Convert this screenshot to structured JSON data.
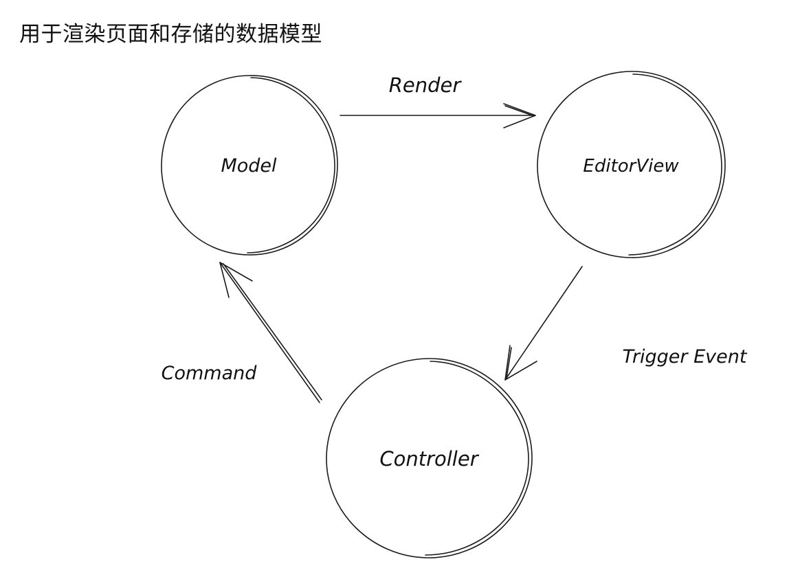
{
  "title": "用于渲染页面和存储的数据模型",
  "nodes": {
    "model": "Model",
    "editor_view": "EditorView",
    "controller": "Controller"
  },
  "edges": {
    "render": "Render",
    "trigger_event": "Trigger Event",
    "command": "Command"
  }
}
